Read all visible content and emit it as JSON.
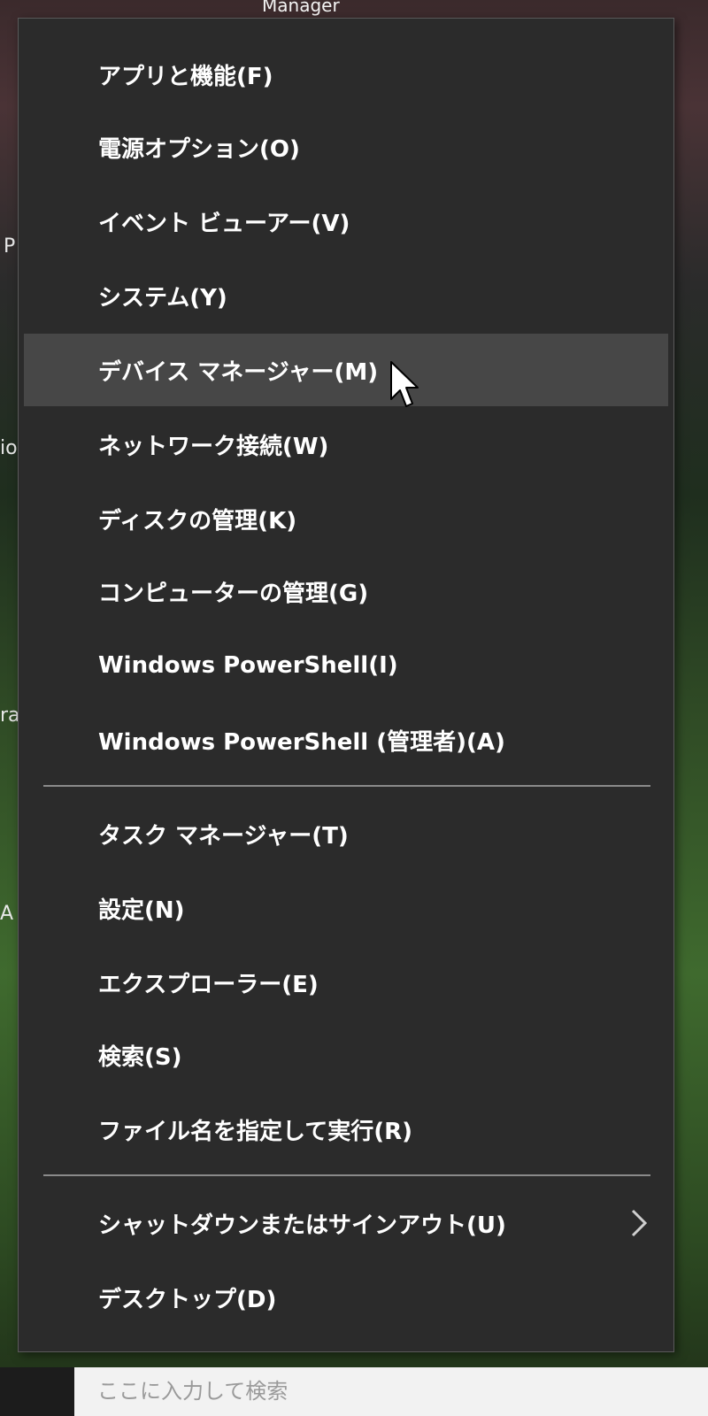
{
  "background": {
    "top_fragment": "Manager",
    "left_fragments": [
      "P",
      "io",
      "ra",
      "A"
    ],
    "search_placeholder": "ここに入力して検索"
  },
  "menu": {
    "groups": [
      {
        "items": [
          {
            "label": "アプリと機能(F)"
          },
          {
            "label": "電源オプション(O)"
          },
          {
            "label": "イベント ビューアー(V)"
          },
          {
            "label": "システム(Y)"
          },
          {
            "label": "デバイス マネージャー(M)",
            "hovered": true
          },
          {
            "label": "ネットワーク接続(W)"
          },
          {
            "label": "ディスクの管理(K)"
          },
          {
            "label": "コンピューターの管理(G)"
          },
          {
            "label": "Windows PowerShell(I)"
          },
          {
            "label": "Windows PowerShell (管理者)(A)"
          }
        ]
      },
      {
        "items": [
          {
            "label": "タスク マネージャー(T)"
          },
          {
            "label": "設定(N)"
          },
          {
            "label": "エクスプローラー(E)"
          },
          {
            "label": "検索(S)"
          },
          {
            "label": "ファイル名を指定して実行(R)"
          }
        ]
      },
      {
        "items": [
          {
            "label": "シャットダウンまたはサインアウト(U)",
            "submenu": true
          },
          {
            "label": "デスクトップ(D)"
          }
        ]
      }
    ],
    "colors": {
      "background": "#2b2b2b",
      "hover": "#474747",
      "text": "#ffffff",
      "separator": "#8a8a8a"
    }
  }
}
